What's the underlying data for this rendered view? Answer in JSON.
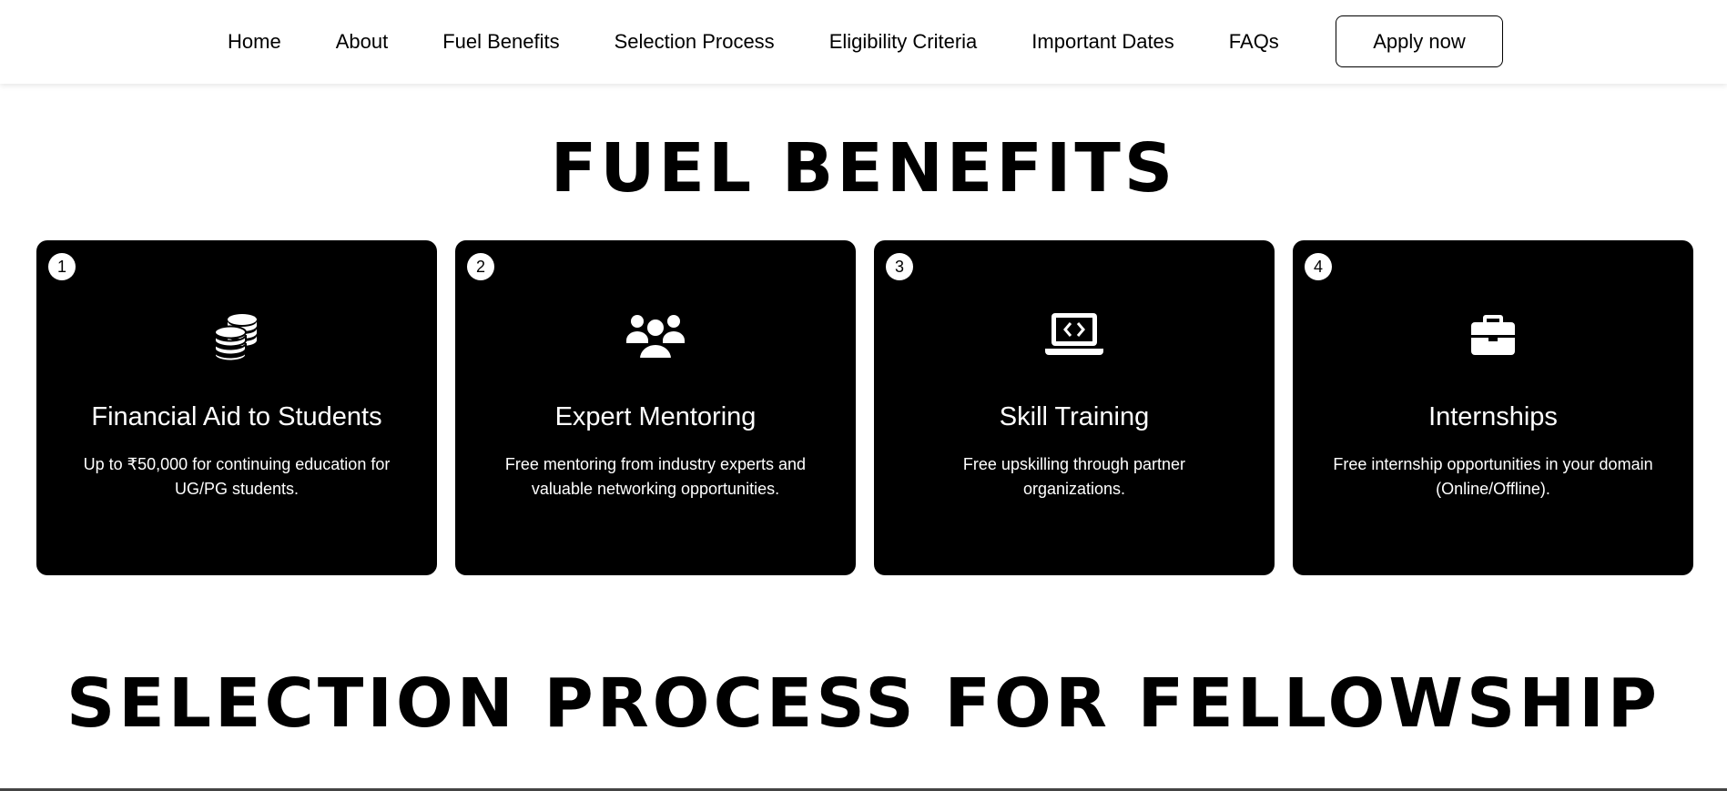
{
  "nav": {
    "links": [
      "Home",
      "About",
      "Fuel Benefits",
      "Selection Process",
      "Eligibility Criteria",
      "Important Dates",
      "FAQs"
    ],
    "apply_label": "Apply now"
  },
  "benefits": {
    "title": "FUEL BENEFITS",
    "cards": [
      {
        "number": "1",
        "icon": "coins-icon",
        "title": "Financial Aid to Students",
        "description": "Up to ₹50,000 for continuing education for UG/PG students."
      },
      {
        "number": "2",
        "icon": "users-icon",
        "title": "Expert Mentoring",
        "description": "Free mentoring from industry experts and valuable networking opportunities."
      },
      {
        "number": "3",
        "icon": "laptop-code-icon",
        "title": "Skill Training",
        "description": "Free upskilling through partner organizations."
      },
      {
        "number": "4",
        "icon": "briefcase-icon",
        "title": "Internships",
        "description": "Free internship opportunities in your domain (Online/Offline)."
      }
    ]
  },
  "selection": {
    "title": "SELECTION PROCESS FOR FELLOWSHIP"
  },
  "colors": {
    "card_background": "#000000",
    "page_background": "#ffffff",
    "text_on_card": "#ffffff"
  }
}
